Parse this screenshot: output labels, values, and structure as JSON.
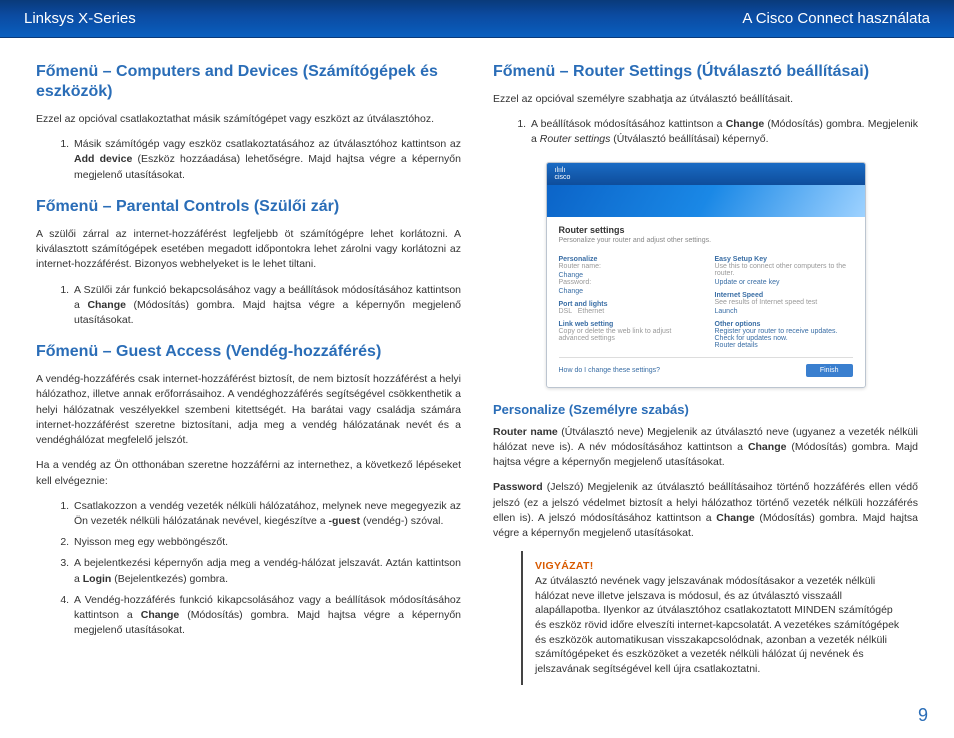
{
  "header": {
    "left": "Linksys X-Series",
    "right": "A Cisco Connect használata"
  },
  "left_col": {
    "s1": {
      "title": "Főmenü – Computers and Devices (Számítógépek és eszközök)",
      "p1": "Ezzel az opcióval csatlakoztathat másik számítógépet vagy eszközt az útválasztóhoz.",
      "li1": "Másik számítógép vagy eszköz csatlakoztatásához az útválasztóhoz kattintson az <b>Add device</b> (Eszköz hozzáadása) lehetőségre. Majd hajtsa végre a képernyőn megjelenő utasításokat."
    },
    "s2": {
      "title": "Főmenü – Parental Controls (Szülői zár)",
      "p1": "A szülői zárral az internet-hozzáférést legfeljebb öt számítógépre lehet korlátozni. A kiválasztott számítógépek esetében megadott időpontokra lehet zárolni vagy korlátozni az internet-hozzáférést. Bizonyos webhelyeket is le lehet tiltani.",
      "li1": "A Szülői zár funkció bekapcsolásához vagy a beállítások módosításához kattintson a <b>Change</b> (Módosítás) gombra. Majd hajtsa végre a képernyőn megjelenő utasításokat."
    },
    "s3": {
      "title": "Főmenü – Guest Access (Vendég-hozzáférés)",
      "p1": "A vendég-hozzáférés csak internet-hozzáférést biztosít, de nem biztosít hozzáférést a helyi hálózathoz, illetve annak erőforrásaihoz. A vendéghozzáférés segítségével csökkenthetik a helyi hálózatnak veszélyekkel szembeni kitettségét. Ha barátai vagy családja számára internet-hozzáférést szeretne biztosítani, adja meg a vendég hálózatának nevét és a vendéghálózat megfelelő jelszót.",
      "p2": "Ha a vendég az Ön otthonában szeretne hozzáférni az internethez, a következő lépéseket kell elvégeznie:",
      "li1": "Csatlakozzon a vendég vezeték nélküli hálózatához, melynek neve megegyezik az Ön vezeték nélküli hálózatának nevével, kiegészítve a <b>-guest</b> (vendég-) szóval.",
      "li2": "Nyisson meg egy webböngészőt.",
      "li3": "A bejelentkezési képernyőn adja meg a vendég-hálózat jelszavát. Aztán kattintson a <b>Login</b> (Bejelentkezés) gombra.",
      "li4": "A Vendég-hozzáférés funkció kikapcsolásához vagy a beállítások módosításához kattintson a <b>Change</b> (Módosítás) gombra. Majd hajtsa végre a képernyőn megjelenő utasításokat."
    }
  },
  "right_col": {
    "s1": {
      "title": "Főmenü – Router Settings (Útválasztó beállításai)",
      "p1": "Ezzel az opcióval személyre szabhatja az útválasztó beállításait.",
      "li1": "A beállítások módosításához kattintson a <b>Change</b> (Módosítás) gombra. Megjelenik a <i>Router settings</i> (Útválasztó beállításai) képernyő."
    },
    "sub": {
      "title": "Personalize (Személyre szabás)",
      "p1": "<b>Router name</b> (Útválasztó neve) Megjelenik az útválasztó neve (ugyanez a vezeték nélküli hálózat neve is). A név módosításához kattintson a <b>Change</b> (Módosítás) gombra. Majd hajtsa végre a képernyőn megjelenő utasításokat.",
      "p2": "<b>Password</b> (Jelszó)  Megjelenik az útválasztó beállításaihoz történő hozzáférés ellen védő jelszó (ez a jelszó védelmet biztosít a helyi hálózathoz történő vezeték nélküli hozzáférés ellen is). A jelszó módosításához kattintson a <b>Change</b> (Módosítás) gombra. Majd hajtsa végre a képernyőn megjelenő utasításokat."
    },
    "callout": {
      "title": "VIGYÁZAT!",
      "body": "Az útválasztó nevének vagy jelszavának módosításakor a vezeték nélküli hálózat neve illetve jelszava is módosul, és az útválasztó visszaáll alapállapotba. Ilyenkor az útválasztóhoz csatlakoztatott MINDEN számítógép és eszköz rövid időre elveszíti internet-kapcsolatát. A vezetékes számítógépek és eszközök automatikusan visszakapcsolódnak, azonban a vezeték nélküli számítógépeket és eszközöket a vezeték nélküli hálózat új nevének és jelszavának segítségével kell újra csatlakoztatni."
    }
  },
  "mock": {
    "logo_top": "ılıılı",
    "logo_bot": "cisco",
    "title": "Router settings",
    "sub": "Personalize your router and adjust other settings.",
    "left": {
      "h1": "Personalize",
      "l1": "Router name:",
      "v1": "Change",
      "l2": "Password:",
      "v2": "Change",
      "h2": "Port and lights",
      "l3a": "DSL",
      "l3b": "Ethernet",
      "h3": "Link web setting",
      "l4": "Copy or delete the web link to adjust advanced settings"
    },
    "right": {
      "h1": "Easy Setup Key",
      "l1": "Use this to connect other computers to the router.",
      "v1": "Update or create key",
      "h2": "Internet Speed",
      "l2": "See results of Internet speed test",
      "v2": "Launch",
      "h3": "Other options",
      "l3": "Register your router to receive updates.",
      "l4": "Check for updates now.",
      "l5": "Router details"
    },
    "foot_link": "How do I change these settings?",
    "foot_btn": "Finish"
  },
  "page_number": "9"
}
